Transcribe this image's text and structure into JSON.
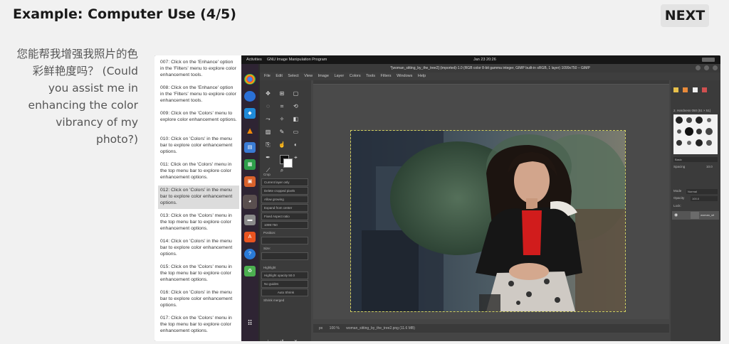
{
  "slide": {
    "title": "Example: Computer Use (4/5)",
    "next_label": "NEXT",
    "prompt": "您能帮我增强我照片的色彩鲜艳度吗？ (Could you assist me in enhancing the color vibrancy of my photo?)"
  },
  "steps": [
    {
      "text": "007: Click on the 'Enhance' option in the 'Filters' menu to explore color enhancement tools."
    },
    {
      "text": "008: Click on the 'Enhance' option in the 'Filters' menu to explore color enhancement tools."
    },
    {
      "text": "009: Click on the 'Colors' menu to explore color enhancement options."
    },
    {
      "text": "010: Click on 'Colors' in the menu bar to explore color enhancement options."
    },
    {
      "text": "011: Click on the 'Colors' menu in the top menu bar to explore color enhancement options."
    },
    {
      "text": "012: Click on 'Colors' in the menu bar to explore color enhancement options.",
      "active": true
    },
    {
      "text": "013: Click on the 'Colors' menu in the top menu bar to explore color enhancement options."
    },
    {
      "text": "014: Click on 'Colors' in the menu bar to explore color enhancement options."
    },
    {
      "text": "015: Click on the 'Colors' menu in the top menu bar to explore color enhancement options."
    },
    {
      "text": "016: Click on 'Colors' in the menu bar to explore color enhancement options."
    },
    {
      "text": "017: Click on the 'Colors' menu in the top menu bar to explore color enhancement options."
    }
  ],
  "topbar": {
    "activities": "Activities",
    "app_name": "GNU Image Manipulation Program",
    "clock": "Jan 23 20:26"
  },
  "gimp": {
    "window_title": "*[woman_sitting_by_the_tree2] (imported)-1.0 (RGB color 8-bit gamma integer, GIMP built-in sRGB, 1 layer) 1099x750 – GIMP",
    "menu": [
      "File",
      "Edit",
      "Select",
      "View",
      "Image",
      "Layer",
      "Colors",
      "Tools",
      "Filters",
      "Windows",
      "Help"
    ],
    "tool_options": {
      "section": "Crop",
      "items": [
        "Current layer only",
        "Delete cropped pixels",
        "Allow growing",
        "Expand from center",
        "Fixed  Aspect ratio",
        "1099:750",
        "Position:",
        "Size:",
        "Highlight",
        "Highlight opacity  50.0",
        "No guides",
        "Auto Shrink",
        "Shrink merged"
      ]
    },
    "status": {
      "unit": "px",
      "zoom": "100 %",
      "file": "woman_sitting_by_the_tree2.png (11.6 MB)"
    },
    "brushes_label": "2. Hardness 050 (51 × 51)",
    "brush_filter": "Basic",
    "spacing_label": "Spacing",
    "spacing_value": "10.0",
    "mode_label": "Mode",
    "mode_value": "Normal",
    "opacity_label": "Opacity",
    "opacity_value": "100.0",
    "lock_label": "Lock:",
    "layer_name": "woman_sit"
  },
  "colors": {
    "page_bg": "#f1f1f1",
    "gimp_bg": "#454545",
    "dock_bg": "#2e2433",
    "active_step": "#dcdcdc"
  },
  "icons": {
    "dock": [
      "chrome-icon",
      "thunderbird-icon",
      "vscode-icon",
      "vlc-icon",
      "libreoffice-writer-icon",
      "libreoffice-calc-icon",
      "libreoffice-impress-icon",
      "gimp-icon",
      "files-icon",
      "software-center-icon",
      "help-icon",
      "trash-icon",
      "apps-grid-icon"
    ]
  }
}
